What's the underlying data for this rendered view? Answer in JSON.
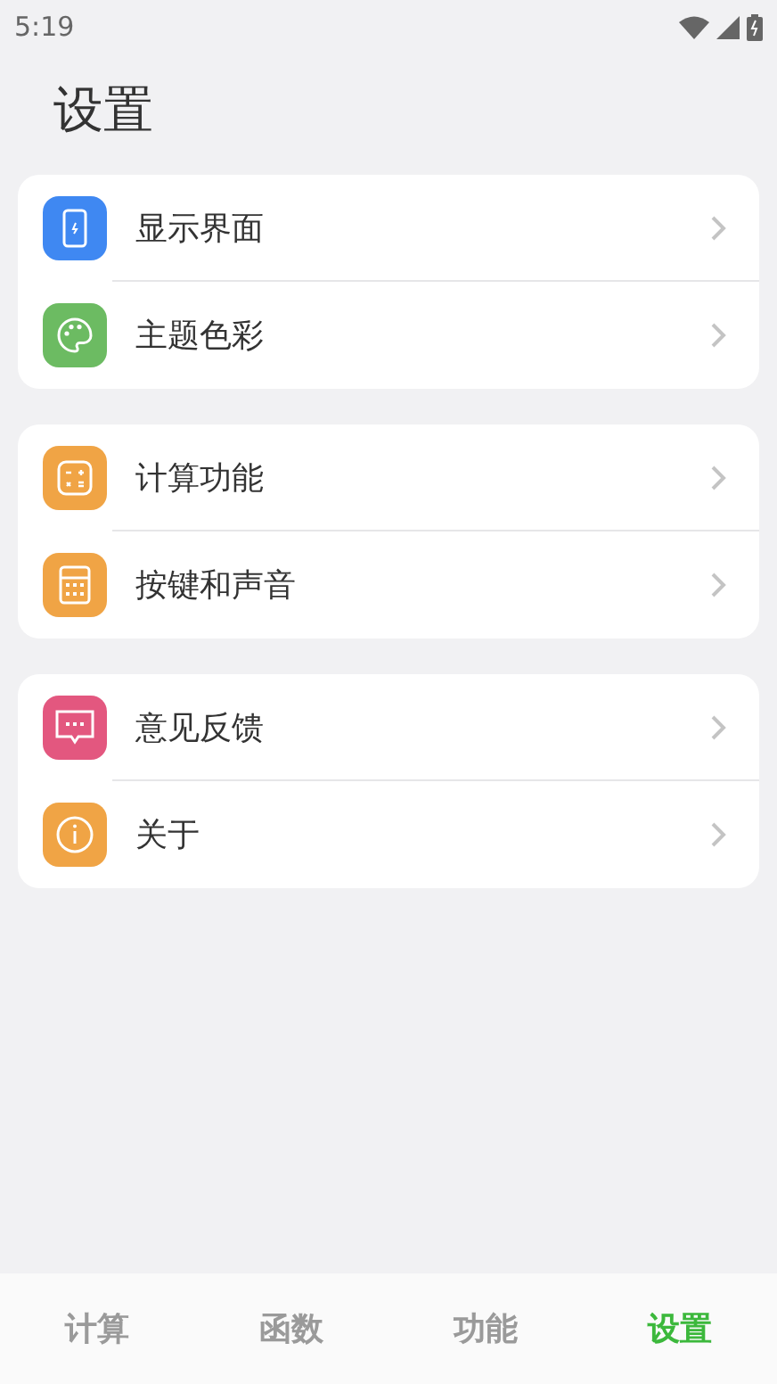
{
  "status_bar": {
    "time": "5:19"
  },
  "title": "设置",
  "groups": [
    {
      "items": [
        {
          "label": "显示界面",
          "color": "#3f88f2"
        },
        {
          "label": "主题色彩",
          "color": "#6cbb62"
        }
      ]
    },
    {
      "items": [
        {
          "label": "计算功能",
          "color": "#f0a445"
        },
        {
          "label": "按键和声音",
          "color": "#f0a445"
        }
      ]
    },
    {
      "items": [
        {
          "label": "意见反馈",
          "color": "#e3577f"
        },
        {
          "label": "关于",
          "color": "#f0a445"
        }
      ]
    }
  ],
  "tabs": [
    {
      "label": "计算",
      "selected": false
    },
    {
      "label": "函数",
      "selected": false
    },
    {
      "label": "功能",
      "selected": false
    },
    {
      "label": "设置",
      "selected": true
    }
  ]
}
